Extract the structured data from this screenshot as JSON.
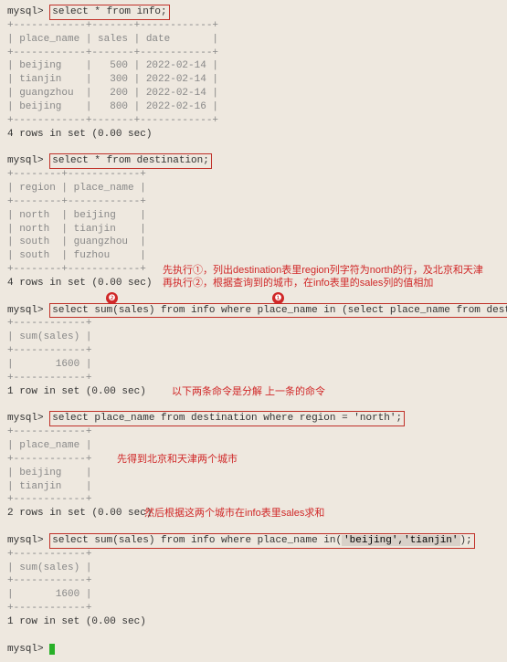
{
  "prompt": "mysql>",
  "q1": "select * from info;",
  "info": {
    "sep": "+------------+-------+------------+",
    "hdr": "| place_name | sales | date       |",
    "rows": [
      "| beijing    |   500 | 2022-02-14 |",
      "| tianjin    |   300 | 2022-02-14 |",
      "| guangzhou  |   200 | 2022-02-14 |",
      "| beijing    |   800 | 2022-02-16 |"
    ],
    "msg": "4 rows in set (0.00 sec)"
  },
  "q2": "select * from destination;",
  "dest": {
    "sep": "+--------+------------+",
    "hdr": "| region | place_name |",
    "rows": [
      "| north  | beijing    |",
      "| north  | tianjin    |",
      "| south  | guangzhou  |",
      "| south  | fuzhou     |"
    ],
    "msg": "4 rows in set (0.00 sec)"
  },
  "ann1_a": "先执行①，列出destination表里region列字符为north的行，及北京和天津",
  "ann1_b": "再执行②，根据查询到的城市，在info表里的sales列的值相加",
  "badge2": "❷",
  "badge1": "❶",
  "q3a": "select sum(sales) from info where place_name in (",
  "q3b": "select place_name from destination where region = 'north');",
  "sum": {
    "sep": "+------------+",
    "hdr": "| sum(sales) |",
    "row": "|       1600 |",
    "msg": "1 row in set (0.00 sec)"
  },
  "ann2": "以下两条命令是分解 上一条的命令",
  "q4": "select place_name from destination where region = 'north';",
  "place": {
    "sep": "+------------+",
    "hdr": "| place_name |",
    "rows": [
      "| beijing    |",
      "| tianjin    |"
    ],
    "msg": "2 rows in set (0.00 sec)"
  },
  "ann3": "先得到北京和天津两个城市",
  "ann4": "然后根据这两个城市在info表里sales求和",
  "q5a": "select sum(sales) from info where place_name in(",
  "q5b": "'beijing','tianjin'",
  "q5c": ");",
  "sum2_msg": "1 row in set (0.00 sec)"
}
